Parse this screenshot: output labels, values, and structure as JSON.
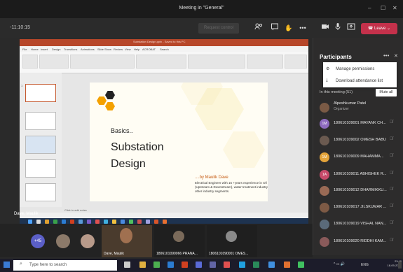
{
  "window": {
    "title": "Meeting in \"General\""
  },
  "toolbar": {
    "timer": "-11:10:15",
    "request_control": "Request control",
    "leave": "Leave"
  },
  "presentation": {
    "file_title": "Substation Design.pptx - Saved to this PC",
    "menu": [
      "File",
      "Home",
      "Insert",
      "Design",
      "Transitions",
      "Animations",
      "Slide Show",
      "Review",
      "View",
      "Help",
      "ACROBAT",
      "Search"
    ],
    "slide": {
      "kicker": "Basics..",
      "title_line1": "Substation",
      "title_line2": "Design",
      "author": "....by Maulik Dave",
      "description": "Electrical Engineer with 15 +years experience in Oil & Gas (Upstream & Downstream), water treatment industry and other industry segments."
    },
    "notes_placeholder": "Click to add notes",
    "presenter": "Dave, Maulik"
  },
  "strip": {
    "overflow_count": "+45",
    "tiles": [
      {
        "name": "Dave, Maulik"
      },
      {
        "name": "1806101090066 PRANA..."
      },
      {
        "name": "1806101090001 OMES..."
      }
    ]
  },
  "sidebar": {
    "title": "Participants",
    "menu": [
      "Manage permissions",
      "Download attendance list"
    ],
    "in_meeting": "In this meeting (51)",
    "mute_all": "Mute all",
    "participants": [
      {
        "name": "Alpeshkumar Patel",
        "role": "Organizer",
        "color": "#7a5a45"
      },
      {
        "name": "180610109001 MAYANK CH...",
        "initials": "1M",
        "color": "#8e6bbf"
      },
      {
        "name": "180610109002 OMESH BABU",
        "color": "#6b5a50"
      },
      {
        "name": "180610109009 MAHAMMA...",
        "initials": "1M",
        "color": "#e3a33a"
      },
      {
        "name": "180610109011 ABHISHEK R...",
        "initials": "1A",
        "color": "#c74a6a"
      },
      {
        "name": "180610109012 DHARMIKKU...",
        "color": "#9a6a55"
      },
      {
        "name": "180610109017 JILSKUMAR ...",
        "color": "#7d5a45"
      },
      {
        "name": "180610109019 VISHAL NAN...",
        "color": "#5a6a7a"
      },
      {
        "name": "180610109020 RIDDHI KAM...",
        "color": "#8a5a5a"
      }
    ]
  },
  "taskbar": {
    "search_placeholder": "Type here to search",
    "lang": "ENG",
    "time": "23:49",
    "date": "18-09-2020"
  }
}
